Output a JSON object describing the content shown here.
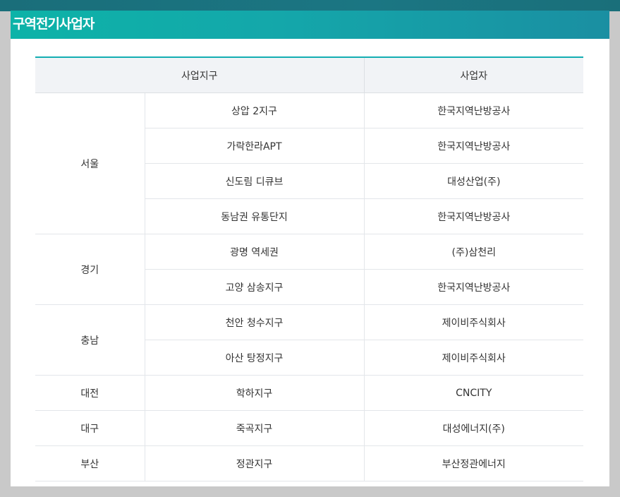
{
  "page": {
    "title": "구역전기사업자"
  },
  "table": {
    "headers": {
      "district": "사업지구",
      "operator": "사업자"
    },
    "groups": [
      {
        "region": "서울",
        "rows": [
          {
            "district": "상압 2지구",
            "operator": "한국지역난방공사"
          },
          {
            "district": "가락한라APT",
            "operator": "한국지역난방공사"
          },
          {
            "district": "신도림 디큐브",
            "operator": "대성산업(주)"
          },
          {
            "district": "동남권 유통단지",
            "operator": "한국지역난방공사"
          }
        ]
      },
      {
        "region": "경기",
        "rows": [
          {
            "district": "광명 역세권",
            "operator": "(주)삼천리"
          },
          {
            "district": "고양 삼송지구",
            "operator": "한국지역난방공사"
          }
        ]
      },
      {
        "region": "충남",
        "rows": [
          {
            "district": "천안 청수지구",
            "operator": "제이비주식회사"
          },
          {
            "district": "아산 탕정지구",
            "operator": "제이비주식회사"
          }
        ]
      },
      {
        "region": "대전",
        "rows": [
          {
            "district": "학하지구",
            "operator": "CNCITY"
          }
        ]
      },
      {
        "region": "대구",
        "rows": [
          {
            "district": "죽곡지구",
            "operator": "대성에너지(주)"
          }
        ]
      },
      {
        "region": "부산",
        "rows": [
          {
            "district": "정관지구",
            "operator": "부산정관에너지"
          }
        ]
      }
    ]
  },
  "colors": {
    "title_bar": "#0db3a8",
    "header_top_border": "#14aeb2",
    "header_bg": "#f1f3f6"
  }
}
